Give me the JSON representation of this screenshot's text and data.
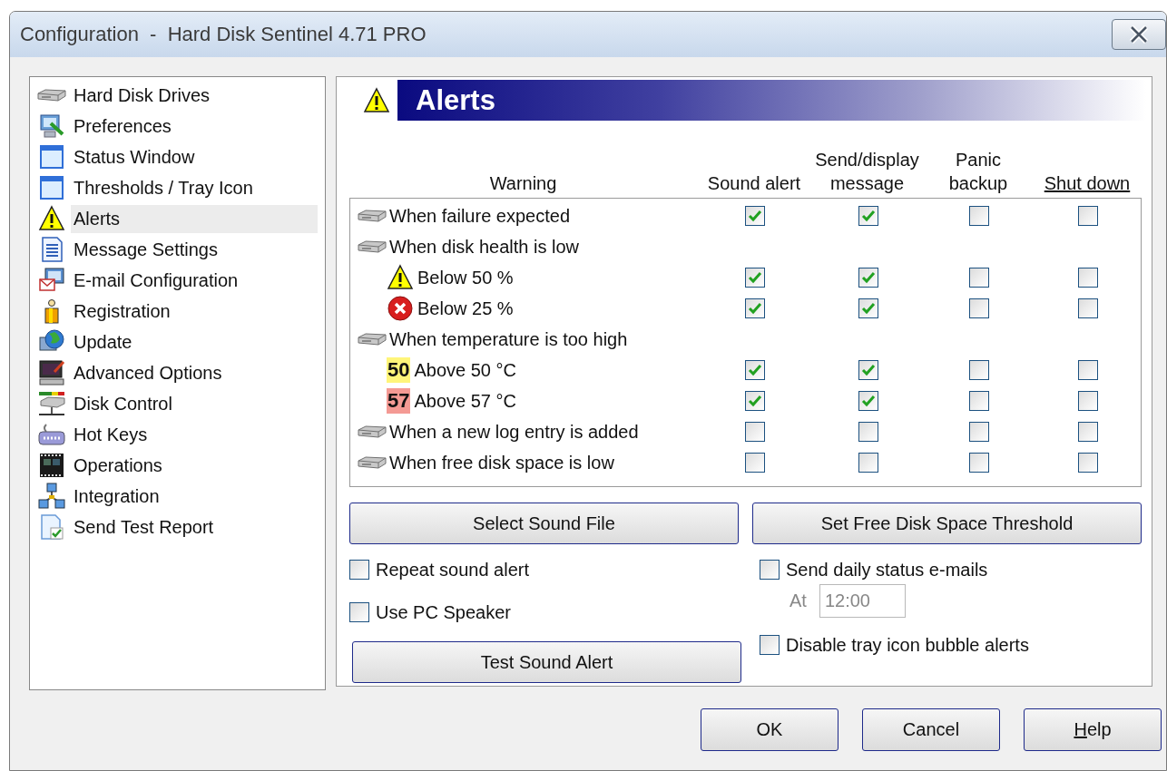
{
  "window": {
    "title": "Configuration  -  Hard Disk Sentinel 4.71 PRO"
  },
  "sidebar": {
    "items": [
      {
        "label": "Hard Disk Drives",
        "selected": false
      },
      {
        "label": "Preferences",
        "selected": false
      },
      {
        "label": "Status Window",
        "selected": false
      },
      {
        "label": "Thresholds / Tray Icon",
        "selected": false
      },
      {
        "label": "Alerts",
        "selected": true
      },
      {
        "label": "Message Settings",
        "selected": false
      },
      {
        "label": "E-mail Configuration",
        "selected": false
      },
      {
        "label": "Registration",
        "selected": false
      },
      {
        "label": "Update",
        "selected": false
      },
      {
        "label": "Advanced Options",
        "selected": false
      },
      {
        "label": "Disk Control",
        "selected": false
      },
      {
        "label": "Hot Keys",
        "selected": false
      },
      {
        "label": "Operations",
        "selected": false
      },
      {
        "label": "Integration",
        "selected": false
      },
      {
        "label": "Send Test Report",
        "selected": false
      }
    ]
  },
  "panel": {
    "title": "Alerts"
  },
  "alert_table": {
    "columns": [
      {
        "label": "Warning",
        "underlined": false
      },
      {
        "label": "Sound alert",
        "underlined": false
      },
      {
        "label": "Send/display message",
        "underlined": false
      },
      {
        "label": "Panic backup",
        "underlined": false
      },
      {
        "label": "Shut down",
        "underlined": true
      }
    ],
    "rows": [
      {
        "kind": "drive",
        "label": "When failure expected",
        "checks": [
          true,
          true,
          false,
          false
        ]
      },
      {
        "kind": "drive",
        "label": "When disk health is low",
        "children": [
          {
            "kind": "warning",
            "label": "Below 50 %",
            "checks": [
              true,
              true,
              false,
              false
            ]
          },
          {
            "kind": "error",
            "label": "Below 25 %",
            "checks": [
              true,
              true,
              false,
              false
            ]
          }
        ]
      },
      {
        "kind": "drive",
        "label": "When temperature is too high",
        "children": [
          {
            "kind": "badge",
            "label": "Above 50 °C",
            "badge": {
              "text": "50",
              "color": "#fff57a"
            },
            "checks": [
              true,
              true,
              false,
              false
            ]
          },
          {
            "kind": "badge",
            "label": "Above 57 °C",
            "badge": {
              "text": "57",
              "color": "#f49a94"
            },
            "checks": [
              true,
              true,
              false,
              false
            ]
          }
        ]
      },
      {
        "kind": "drive",
        "label": "When a new log entry is added",
        "checks": [
          false,
          false,
          false,
          false
        ]
      },
      {
        "kind": "drive",
        "label": "When free disk space is low",
        "checks": [
          false,
          false,
          false,
          false
        ]
      }
    ]
  },
  "buttons": [
    {
      "label": "Select Sound File"
    },
    {
      "label": "Set Free Disk Space Threshold"
    }
  ],
  "left_options": [
    {
      "kind": "checkbox",
      "label": "Repeat sound alert",
      "checked": false
    },
    {
      "kind": "checkbox",
      "label": "Use PC Speaker",
      "checked": false
    },
    {
      "kind": "button",
      "label": "Test Sound Alert"
    }
  ],
  "right_options": [
    {
      "kind": "checkbox",
      "label": "Send daily status e-mails",
      "checked": false
    },
    {
      "kind": "time",
      "label": "At",
      "value": "12:00",
      "disabled": true
    },
    {
      "kind": "checkbox",
      "label": "Disable tray icon bubble alerts",
      "checked": false
    }
  ],
  "dialog_buttons": [
    {
      "label": "OK",
      "underline_first": false
    },
    {
      "label": "Cancel",
      "underline_first": false
    },
    {
      "label": "Help",
      "underline_first": true
    }
  ]
}
